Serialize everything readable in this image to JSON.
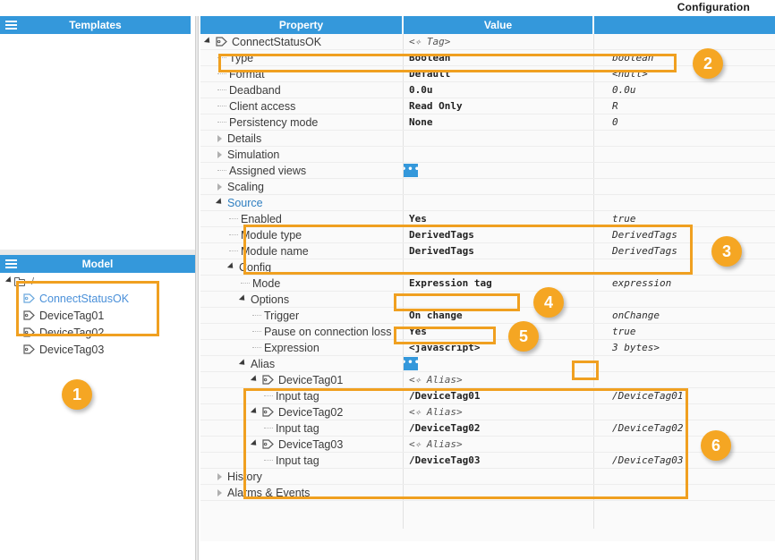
{
  "window": {
    "configuration_label": "Configuration"
  },
  "templates_panel": {
    "title": "Templates",
    "menu_icon": "hamburger-icon"
  },
  "model_panel": {
    "title": "Model",
    "menu_icon": "hamburger-icon",
    "root_label": "/",
    "items": [
      {
        "label": "ConnectStatusOK",
        "selected": true
      },
      {
        "label": "DeviceTag01",
        "selected": false
      },
      {
        "label": "DeviceTag02",
        "selected": false
      },
      {
        "label": "DeviceTag03",
        "selected": false
      }
    ]
  },
  "property_grid": {
    "columns": [
      "Property",
      "Value",
      ""
    ],
    "rows": [
      {
        "property": "ConnectStatusOK",
        "value": "<✧ Tag>",
        "extra": "",
        "depth": 0,
        "twisty": "down",
        "icon": "tag-icon",
        "value_style": "italic"
      },
      {
        "property": "Type",
        "value": "Boolean",
        "extra": "boolean",
        "depth": 1,
        "twisty": "leaf",
        "widget": "dropdown"
      },
      {
        "property": "Format",
        "value": "Default",
        "extra": "<null>",
        "depth": 1,
        "twisty": "leaf",
        "widget": "dropdown"
      },
      {
        "property": "Deadband",
        "value": "0.0u",
        "extra": "0.0u",
        "depth": 1,
        "twisty": "leaf",
        "widget": "none"
      },
      {
        "property": "Client access",
        "value": "Read Only",
        "extra": "R",
        "depth": 1,
        "twisty": "leaf",
        "widget": "dropdown"
      },
      {
        "property": "Persistency mode",
        "value": "None",
        "extra": "0",
        "depth": 1,
        "twisty": "leaf",
        "widget": "dropdown"
      },
      {
        "property": "Details",
        "value": "",
        "extra": "",
        "depth": 1,
        "twisty": "right",
        "widget": "none"
      },
      {
        "property": "Simulation",
        "value": "",
        "extra": "",
        "depth": 1,
        "twisty": "right",
        "widget": "none"
      },
      {
        "property": "Assigned views",
        "value": "",
        "extra": "",
        "depth": 1,
        "twisty": "leaf",
        "widget": "dots"
      },
      {
        "property": "Scaling",
        "value": "",
        "extra": "",
        "depth": 1,
        "twisty": "right",
        "widget": "none"
      },
      {
        "property": "Source",
        "value": "",
        "extra": "",
        "depth": 1,
        "twisty": "down",
        "widget": "none",
        "group": true
      },
      {
        "property": "Enabled",
        "value": "Yes",
        "extra": "true",
        "depth": 2,
        "twisty": "leaf",
        "widget": "dropdown"
      },
      {
        "property": "Module type",
        "value": "DerivedTags",
        "extra": "DerivedTags",
        "depth": 2,
        "twisty": "leaf",
        "widget": "dropdown"
      },
      {
        "property": "Module name",
        "value": "DerivedTags",
        "extra": "DerivedTags",
        "depth": 2,
        "twisty": "leaf",
        "widget": "dropdown"
      },
      {
        "property": "Config",
        "value": "",
        "extra": "",
        "depth": 2,
        "twisty": "down",
        "widget": "none"
      },
      {
        "property": "Mode",
        "value": "Expression tag",
        "extra": "expression",
        "depth": 3,
        "twisty": "leaf",
        "widget": "dropdown"
      },
      {
        "property": "Options",
        "value": "",
        "extra": "",
        "depth": 3,
        "twisty": "down",
        "widget": "none"
      },
      {
        "property": "Trigger",
        "value": "On change",
        "extra": "onChange",
        "depth": 4,
        "twisty": "leaf",
        "widget": "dropdown"
      },
      {
        "property": "Pause on connection loss",
        "value": "Yes",
        "extra": "true",
        "depth": 4,
        "twisty": "leaf",
        "widget": "dropdown"
      },
      {
        "property": "Expression",
        "value": "<javascript>",
        "extra": "3 bytes>",
        "depth": 4,
        "twisty": "leaf",
        "widget": "code"
      },
      {
        "property": "Alias",
        "value": "",
        "extra": "",
        "depth": 3,
        "twisty": "down",
        "widget": "dots"
      },
      {
        "property": "DeviceTag01",
        "value": "<✧ Alias>",
        "extra": "",
        "depth": 4,
        "twisty": "down",
        "icon": "tag-icon",
        "widget": "none",
        "value_style": "italic"
      },
      {
        "property": "Input tag",
        "value": "/DeviceTag01",
        "extra": "/DeviceTag01",
        "depth": 5,
        "twisty": "leaf",
        "widget": "tag"
      },
      {
        "property": "DeviceTag02",
        "value": "<✧ Alias>",
        "extra": "",
        "depth": 4,
        "twisty": "down",
        "icon": "tag-icon",
        "widget": "none",
        "value_style": "italic"
      },
      {
        "property": "Input tag",
        "value": "/DeviceTag02",
        "extra": "/DeviceTag02",
        "depth": 5,
        "twisty": "leaf",
        "widget": "tag"
      },
      {
        "property": "DeviceTag03",
        "value": "<✧ Alias>",
        "extra": "",
        "depth": 4,
        "twisty": "down",
        "icon": "tag-icon",
        "widget": "none",
        "value_style": "italic"
      },
      {
        "property": "Input tag",
        "value": "/DeviceTag03",
        "extra": "/DeviceTag03",
        "depth": 5,
        "twisty": "leaf",
        "widget": "tag"
      },
      {
        "property": "History",
        "value": "",
        "extra": "",
        "depth": 1,
        "twisty": "right",
        "widget": "none"
      },
      {
        "property": "Alarms & Events",
        "value": "",
        "extra": "",
        "depth": 1,
        "twisty": "right",
        "widget": "none"
      }
    ]
  },
  "callouts": [
    {
      "number": "1"
    },
    {
      "number": "2"
    },
    {
      "number": "3"
    },
    {
      "number": "4"
    },
    {
      "number": "5"
    },
    {
      "number": "6"
    }
  ],
  "colors": {
    "header_blue": "#3498db",
    "highlight_orange": "#f0a020",
    "badge_orange": "#f5a623",
    "link_blue": "#4a90d9"
  }
}
